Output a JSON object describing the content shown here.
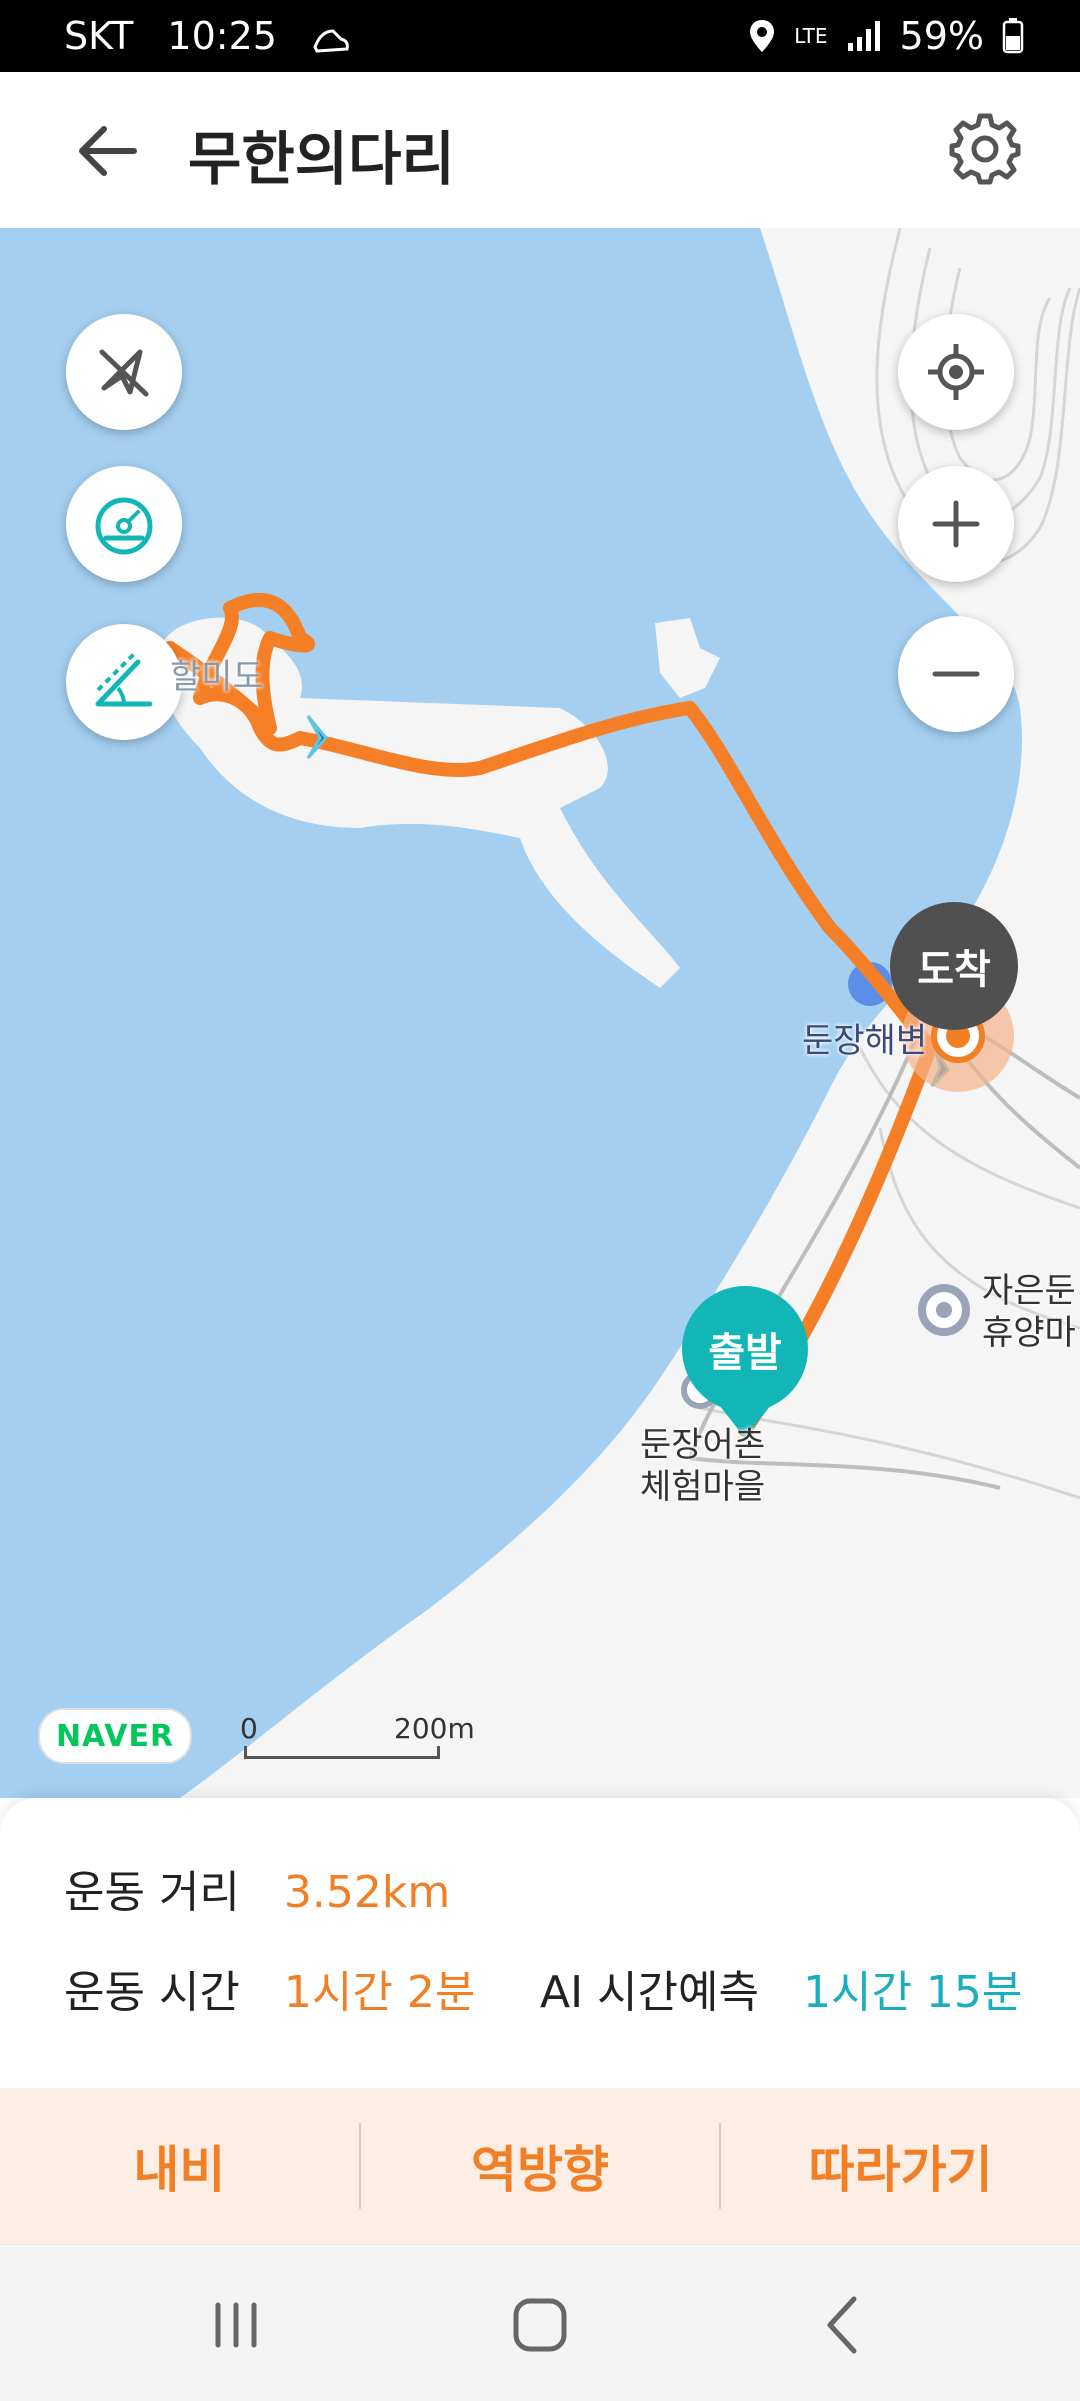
{
  "status_bar": {
    "carrier": "SKT",
    "time": "10:25",
    "network": "LTE",
    "battery": "59%"
  },
  "app_bar": {
    "title": "무한의다리",
    "back_icon": "arrow-left-icon",
    "settings_icon": "gear-icon"
  },
  "map": {
    "tool_buttons": [
      "navigation-off-icon",
      "speedometer-icon",
      "elevation-icon"
    ],
    "control_buttons": [
      "my-location-icon",
      "zoom-in-icon",
      "zoom-out-icon"
    ],
    "labels": {
      "beach": "둔장해변",
      "village1_line1": "둔장어촌",
      "village1_line2": "체험마을",
      "village2_line1": "자은둔",
      "village2_line2": "휴양마",
      "island": "할미도"
    },
    "arrival_label": "도착",
    "start_label": "출발",
    "logo": "NAVER",
    "scale": {
      "zero": "0",
      "max": "200m"
    },
    "colors": {
      "water": "#a4cff0",
      "land": "#f5f5f5",
      "route": "#f57f26",
      "start": "#13b6b7",
      "arrival": "#505050"
    }
  },
  "info": {
    "distance_label": "운동 거리",
    "distance_value": "3.52km",
    "time_label": "운동 시간",
    "time_value": "1시간 2분",
    "ai_label": "AI 시간예측",
    "ai_value": "1시간 15분"
  },
  "actions": {
    "navi": "내비",
    "reverse": "역방향",
    "follow": "따라가기"
  },
  "nav_bar": {
    "recents": "recents-icon",
    "home": "home-icon",
    "back": "back-icon"
  }
}
